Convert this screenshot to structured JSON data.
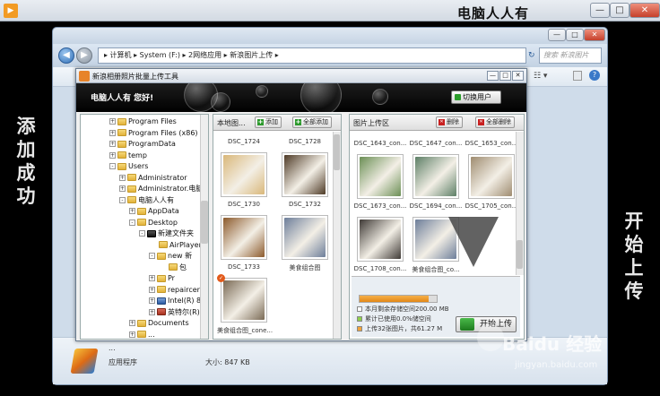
{
  "app": {
    "brand": "电脑人人有"
  },
  "window_controls": {
    "minimize": "—",
    "maximize": "□",
    "close": "✕"
  },
  "side_captions": {
    "left": "添加成功",
    "right": "开始上传"
  },
  "explorer": {
    "address": "▸ 计算机 ▸ System (F:) ▸ 2网络应用 ▸ 新浪图片上传 ▸",
    "search_placeholder": "搜索 新浪图片",
    "selected_file": {
      "name": "...",
      "type": "应用程序",
      "size": "大小: 847 KB"
    }
  },
  "uploader": {
    "title": "新浪相册照片批量上传工具",
    "welcome": "电脑人人有  您好!",
    "switch_user": "切换用户",
    "tree": [
      {
        "label": "Program Files",
        "depth": 0,
        "icon": "folder",
        "expander": "+"
      },
      {
        "label": "Program Files (x86)",
        "depth": 0,
        "icon": "folder",
        "expander": "+"
      },
      {
        "label": "ProgramData",
        "depth": 0,
        "icon": "folder",
        "expander": "+"
      },
      {
        "label": "temp",
        "depth": 0,
        "icon": "folder",
        "expander": "+"
      },
      {
        "label": "Users",
        "depth": 0,
        "icon": "folder",
        "expander": "-"
      },
      {
        "label": "Administrator",
        "depth": 1,
        "icon": "folder",
        "expander": "+"
      },
      {
        "label": "Administrator.电脑",
        "depth": 1,
        "icon": "folder",
        "expander": "+"
      },
      {
        "label": "电脑人人有",
        "depth": 1,
        "icon": "folder",
        "expander": "-"
      },
      {
        "label": "AppData",
        "depth": 2,
        "icon": "folder",
        "expander": "+"
      },
      {
        "label": "Desktop",
        "depth": 2,
        "icon": "folder",
        "expander": "-"
      },
      {
        "label": "新建文件夹",
        "depth": 3,
        "icon": "dark",
        "expander": "-"
      },
      {
        "label": "AirPlayer",
        "depth": 4,
        "icon": "folder",
        "expander": ""
      },
      {
        "label": "new 新",
        "depth": 4,
        "icon": "folder",
        "expander": "-"
      },
      {
        "label": "包",
        "depth": 5,
        "icon": "folder",
        "expander": ""
      },
      {
        "label": "Pr",
        "depth": 4,
        "icon": "folder",
        "expander": "+"
      },
      {
        "label": "repaircer",
        "depth": 4,
        "icon": "folder",
        "expander": "+"
      },
      {
        "label": "Intel(R) 8",
        "depth": 4,
        "icon": "drive",
        "expander": "+"
      },
      {
        "label": "英特尔(R)",
        "depth": 4,
        "icon": "red",
        "expander": "+"
      },
      {
        "label": "Documents",
        "depth": 2,
        "icon": "folder",
        "expander": "+"
      },
      {
        "label": "...",
        "depth": 2,
        "icon": "folder",
        "expander": "+"
      }
    ],
    "local_panel": {
      "title": "本地图...",
      "add": "添加",
      "add_all": "全部添加",
      "items": [
        {
          "label": "DSC_1724",
          "col": 0,
          "row": -1,
          "color": "#c8b89a"
        },
        {
          "label": "DSC_1728",
          "col": 1,
          "row": -1,
          "color": "#b9a57f"
        },
        {
          "label": "DSC_1730",
          "col": 0,
          "row": 0,
          "color": "#d9b779"
        },
        {
          "label": "DSC_1732",
          "col": 1,
          "row": 0,
          "color": "#4e3a26"
        },
        {
          "label": "DSC_1733",
          "col": 0,
          "row": 1,
          "color": "#8c5a2c"
        },
        {
          "label": "美食组合图",
          "col": 1,
          "row": 1,
          "color": "#6d7e9a"
        },
        {
          "label": "美食组合图_cone...",
          "col": 0,
          "row": 2,
          "color": "#7a6a55"
        }
      ]
    },
    "upload_panel": {
      "title": "图片上传区",
      "delete": "删除",
      "delete_all": "全部删除",
      "items": [
        {
          "label": "DSC_1643_con...",
          "col": 0,
          "row": -1,
          "color": "#8aa0b8"
        },
        {
          "label": "DSC_1647_con...",
          "col": 1,
          "row": -1,
          "color": "#92a890"
        },
        {
          "label": "DSC_1653_con...",
          "col": 2,
          "row": -1,
          "color": "#a7b4c5"
        },
        {
          "label": "DSC_1673_con...",
          "col": 0,
          "row": 0,
          "color": "#6b8f55"
        },
        {
          "label": "DSC_1694_con...",
          "col": 1,
          "row": 0,
          "color": "#5d7f66"
        },
        {
          "label": "DSC_1705_con...",
          "col": 2,
          "row": 0,
          "color": "#9f8c70"
        },
        {
          "label": "DSC_1708_con...",
          "col": 0,
          "row": 1,
          "color": "#3f3a36"
        },
        {
          "label": "美食组合图_co...",
          "col": 1,
          "row": 1,
          "color": "#6d7e9a"
        }
      ],
      "progress": 0.9,
      "stats": [
        {
          "text": "本月剩余存储空间200.00 MB",
          "color": "#ffffff"
        },
        {
          "text": "累计已使用0.0%储空间",
          "color": "#8fd04a"
        },
        {
          "text": "上传32张图片，共61.27 M",
          "color": "#f2a43a"
        }
      ],
      "start_upload": "开始上传"
    }
  },
  "watermark": {
    "main": "Baidu 经验",
    "sub": "jingyan.baidu.com"
  }
}
